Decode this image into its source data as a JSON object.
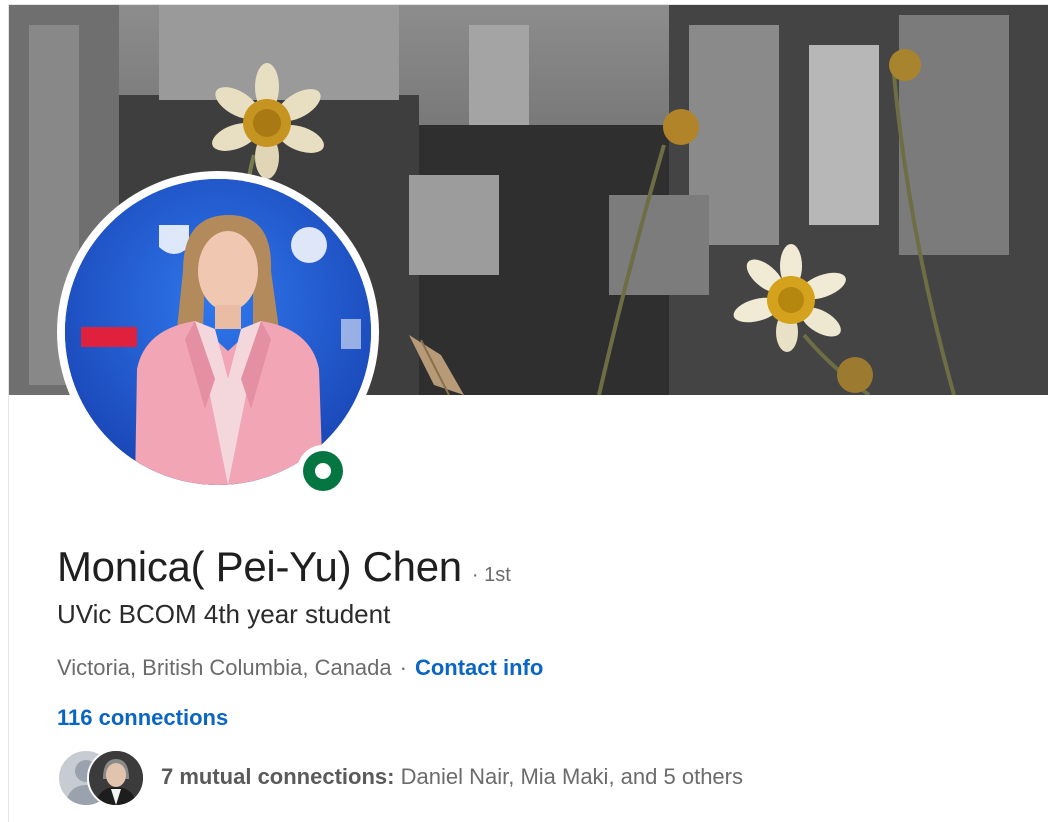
{
  "profile": {
    "name": "Monica( Pei-Yu) Chen",
    "degree": "· 1st",
    "headline": "UVic BCOM 4th year student",
    "location": "Victoria, British Columbia, Canada",
    "separator": "·",
    "contact_label": "Contact info",
    "connections": "116 connections",
    "presence_status": "online"
  },
  "mutual": {
    "count_label": "7 mutual connections:",
    "names": "Daniel Nair, Mia Maki, and 5 others"
  },
  "colors": {
    "link": "#0a66c2",
    "presence": "#057642",
    "avatar_background": "#1f5bd6",
    "blazer": "#f2a5b5"
  }
}
